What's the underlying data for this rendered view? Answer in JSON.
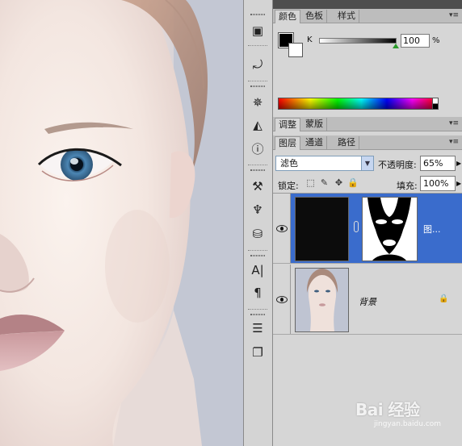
{
  "color_panel": {
    "tabs": [
      "颜色",
      "色板",
      "样式"
    ],
    "channel_label": "K",
    "k_value": "100",
    "unit": "%",
    "foreground_color": "#000000",
    "background_color": "#ffffff"
  },
  "adjust_panel": {
    "tabs": [
      "调整",
      "蒙版"
    ]
  },
  "layers_panel": {
    "tabs": [
      "图层",
      "通道",
      "路径"
    ],
    "blend_mode": "滤色",
    "opacity_label": "不透明度:",
    "opacity_value": "65%",
    "lock_label": "锁定:",
    "fill_label": "填充:",
    "fill_value": "100%",
    "layers": [
      {
        "name": "图...",
        "selected": true
      },
      {
        "name": "背景",
        "selected": false,
        "locked": true
      }
    ]
  },
  "dock": {
    "tools": [
      "histogram-icon",
      "history-icon",
      "navigator-icon",
      "levels-icon",
      "info-icon",
      "tool-presets-icon",
      "brushes-icon",
      "clone-source-icon",
      "character-icon",
      "paragraph-icon",
      "actions-icon",
      "layer-comps-icon"
    ]
  },
  "watermark": {
    "text": "Bai 经验",
    "url": "jingyan.baidu.com"
  },
  "colors": {
    "selection": "#3a6ccc",
    "panel_bg": "#d6d6d6"
  }
}
